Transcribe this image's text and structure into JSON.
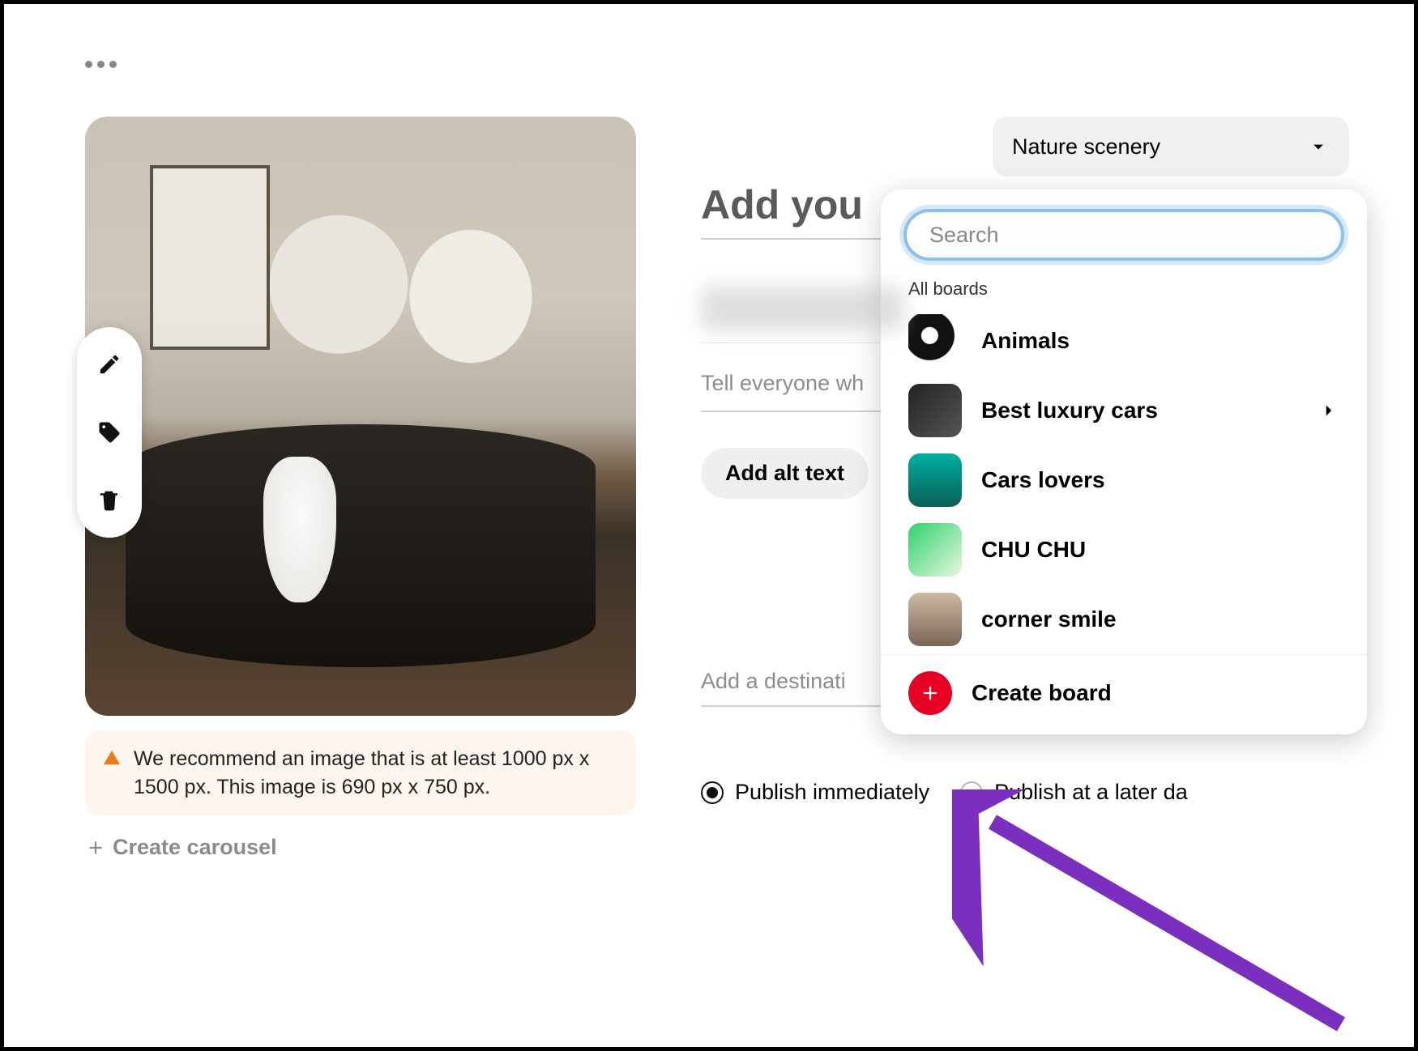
{
  "more_menu_label": "More options",
  "board_selector": {
    "selected": "Nature scenery"
  },
  "dropdown": {
    "search_placeholder": "Search",
    "section_label": "All boards",
    "boards": [
      {
        "name": "Animals"
      },
      {
        "name": "Best luxury cars",
        "has_submenu": true
      },
      {
        "name": "Cars lovers"
      },
      {
        "name": "CHU CHU"
      },
      {
        "name": "corner smile"
      }
    ],
    "create_label": "Create board"
  },
  "form": {
    "title_placeholder": "Add you",
    "desc_placeholder": "Tell everyone wh",
    "alt_button": "Add alt text",
    "link_placeholder": "Add a destinati"
  },
  "warning_text": "We recommend an image that is at least 1000 px x 1500 px. This image is 690 px x 750 px.",
  "create_carousel_label": "Create carousel",
  "publish": {
    "immediate": "Publish immediately",
    "later": "Publish at a later da",
    "selected": "immediate"
  }
}
